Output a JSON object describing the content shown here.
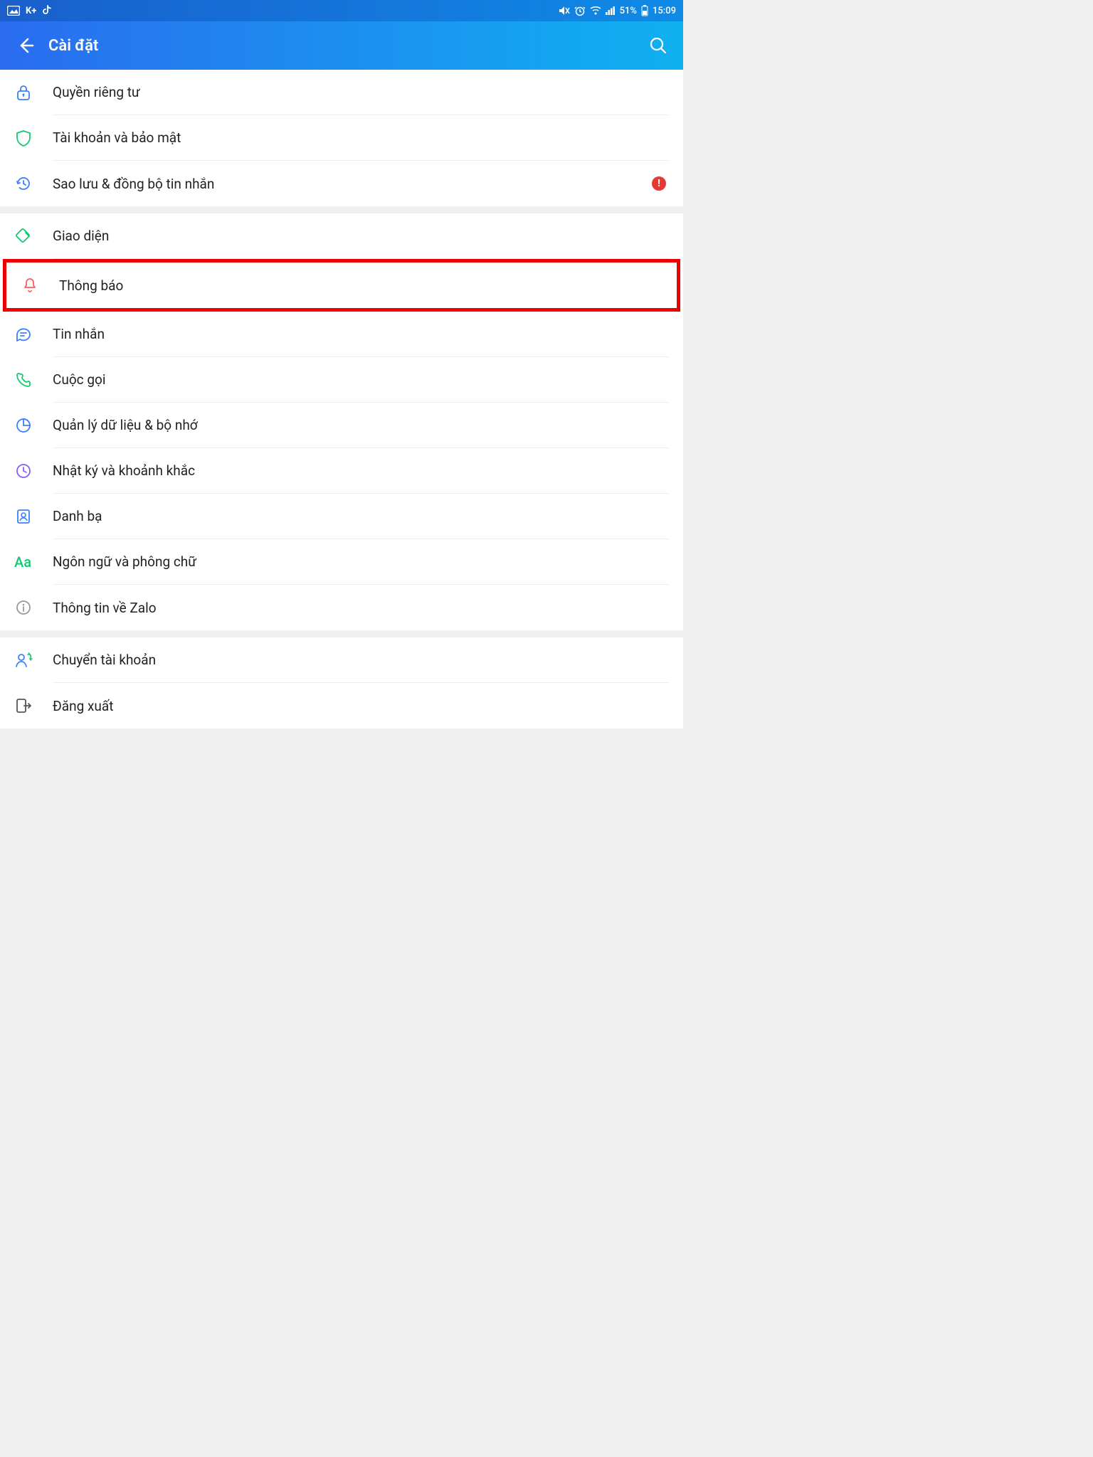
{
  "status_bar": {
    "kplus": "K+",
    "battery_text": "51%",
    "time": "15:09"
  },
  "header": {
    "title": "Cài đặt"
  },
  "sections": [
    {
      "items": [
        {
          "key": "privacy",
          "label": "Quyền riêng tư",
          "icon": "lock-icon",
          "color": "#3d7eff"
        },
        {
          "key": "account",
          "label": "Tài khoản và bảo mật",
          "icon": "shield-icon",
          "color": "#12c971"
        },
        {
          "key": "backup",
          "label": "Sao lưu & đồng bộ tin nhắn",
          "icon": "history-icon",
          "color": "#3d7eff",
          "alert": true
        }
      ]
    },
    {
      "items": [
        {
          "key": "theme",
          "label": "Giao diện",
          "icon": "brush-icon",
          "color": "#12c971"
        },
        {
          "key": "notification",
          "label": "Thông báo",
          "icon": "bell-icon",
          "color": "#ff5c5c",
          "highlight": true
        },
        {
          "key": "message",
          "label": "Tin nhắn",
          "icon": "chat-icon",
          "color": "#3d7eff"
        },
        {
          "key": "call",
          "label": "Cuộc gọi",
          "icon": "phone-icon",
          "color": "#12c971"
        },
        {
          "key": "data",
          "label": "Quản lý dữ liệu & bộ nhớ",
          "icon": "piechart-icon",
          "color": "#3d7eff"
        },
        {
          "key": "diary",
          "label": "Nhật ký và khoảnh khắc",
          "icon": "clock-icon",
          "color": "#8a5cff"
        },
        {
          "key": "contacts",
          "label": "Danh bạ",
          "icon": "contact-icon",
          "color": "#3d7eff"
        },
        {
          "key": "language",
          "label": "Ngôn ngữ và phông chữ",
          "icon": "aa-icon",
          "color": "#12c971"
        },
        {
          "key": "about",
          "label": "Thông tin về Zalo",
          "icon": "info-icon",
          "color": "#999"
        }
      ]
    },
    {
      "items": [
        {
          "key": "switch",
          "label": "Chuyển tài khoản",
          "icon": "switch-user-icon",
          "color": "#3d7eff"
        },
        {
          "key": "logout",
          "label": "Đăng xuất",
          "icon": "logout-icon",
          "color": "#555"
        }
      ]
    }
  ],
  "labels": {
    "privacy": "Quyền riêng tư",
    "account": "Tài khoản và bảo mật",
    "backup": "Sao lưu & đồng bộ tin nhắn",
    "theme": "Giao diện",
    "notification": "Thông báo",
    "message": "Tin nhắn",
    "call": "Cuộc gọi",
    "data": "Quản lý dữ liệu & bộ nhớ",
    "diary": "Nhật ký và khoảnh khắc",
    "contacts": "Danh bạ",
    "language": "Ngôn ngữ và phông chữ",
    "about": "Thông tin về Zalo",
    "switch": "Chuyển tài khoản",
    "logout": "Đăng xuất"
  }
}
